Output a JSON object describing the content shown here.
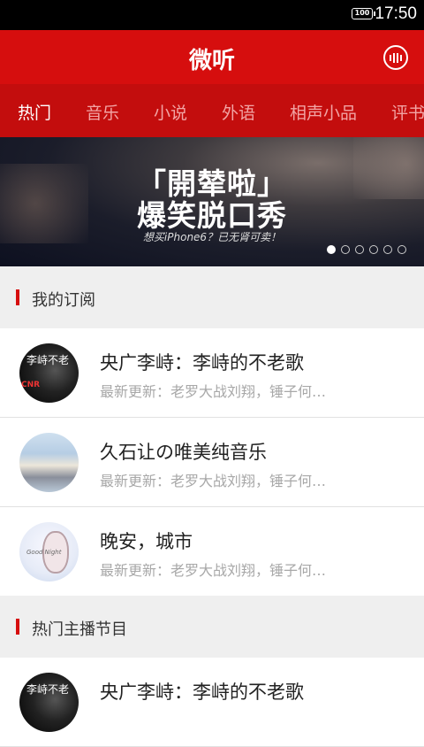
{
  "status_bar": {
    "battery": "100",
    "time": "17:50"
  },
  "app_bar": {
    "title": "微听",
    "radio_icon": "radio-icon"
  },
  "tabs": [
    {
      "label": "热门",
      "active": true
    },
    {
      "label": "音乐",
      "active": false
    },
    {
      "label": "小说",
      "active": false
    },
    {
      "label": "外语",
      "active": false
    },
    {
      "label": "相声小品",
      "active": false
    },
    {
      "label": "评书",
      "active": false
    }
  ],
  "banner": {
    "headline_line1": "「開辇啦」",
    "headline_line2": "爆笑脱口秀",
    "subtitle": "想买iPhone6？已无肾可卖！",
    "page_count": 6,
    "active_page": 1
  },
  "sections": {
    "subscriptions": {
      "title": "我的订阅",
      "items": [
        {
          "title": "央广李峙：李峙的不老歌",
          "subtitle": "最新更新：老罗大战刘翔，锤子何…",
          "avatar_text": "李峙不老",
          "avatar_badge": "CNR"
        },
        {
          "title": "久石让の唯美纯音乐",
          "subtitle": "最新更新：老罗大战刘翔，锤子何…"
        },
        {
          "title": "晚安，城市",
          "subtitle": "最新更新：老罗大战刘翔，锤子何…",
          "avatar_text": "Good Night"
        }
      ]
    },
    "hot_programs": {
      "title": "热门主播节目",
      "items": [
        {
          "title": "央广李峙：李峙的不老歌",
          "avatar_text": "李峙不老"
        }
      ]
    }
  },
  "colors": {
    "brand_red": "#d60e0e",
    "tab_bar_red": "#c30d0d"
  }
}
